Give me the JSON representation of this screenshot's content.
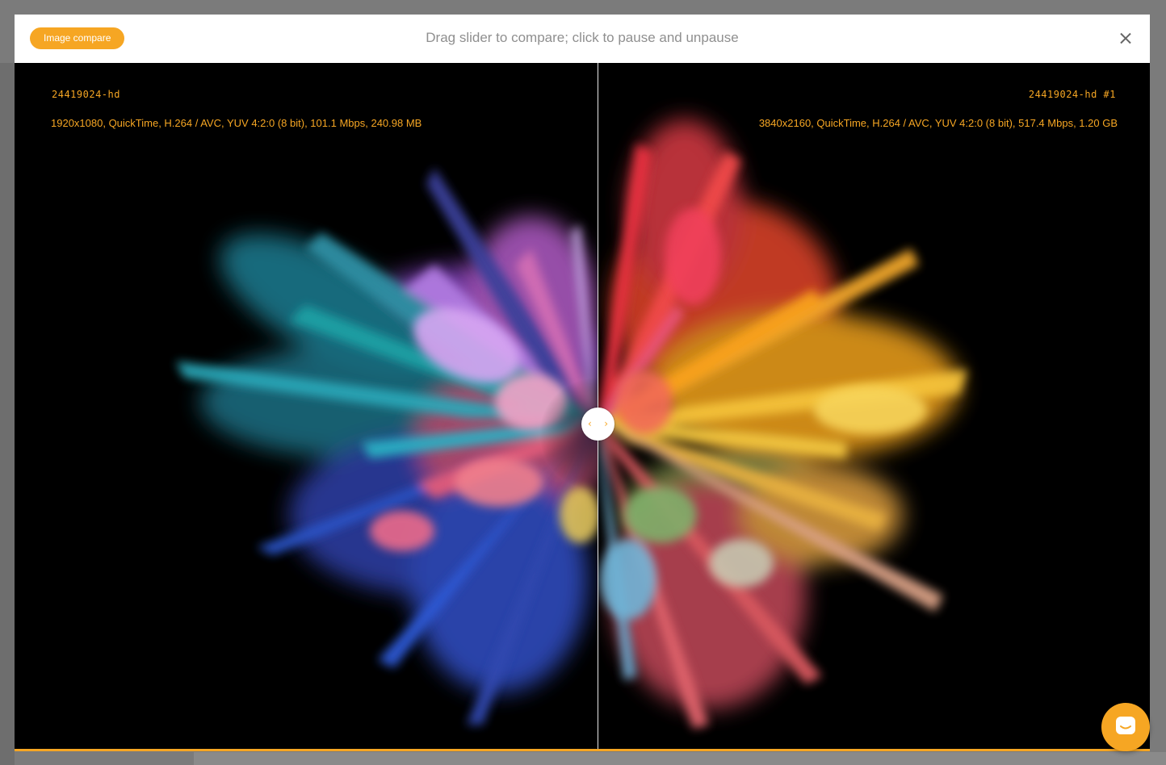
{
  "header": {
    "tag_label": "Image compare",
    "hint_text": "Drag slider to compare; click to pause and unpause",
    "close_icon": "close-icon"
  },
  "compare": {
    "left": {
      "name": "24419024-hd",
      "meta": "1920x1080, QuickTime, H.264 / AVC, YUV 4:2:0 (8 bit), 101.1 Mbps, 240.98 MB"
    },
    "right": {
      "name": "24419024-hd #1",
      "meta": "3840x2160, QuickTime, H.264 / AVC, YUV 4:2:0 (8 bit), 517.4 Mbps, 1.20 GB"
    },
    "slider_position_fraction": 0.514,
    "handle_icons": [
      "chevron-left-icon",
      "chevron-right-icon"
    ]
  },
  "chat": {
    "icon": "chat-icon"
  },
  "colors": {
    "accent": "#f6a623",
    "header_bg": "#ffffff",
    "stage_bg": "#000000",
    "hint_text": "#8f8f8f",
    "backdrop": "#7b7b7b"
  }
}
